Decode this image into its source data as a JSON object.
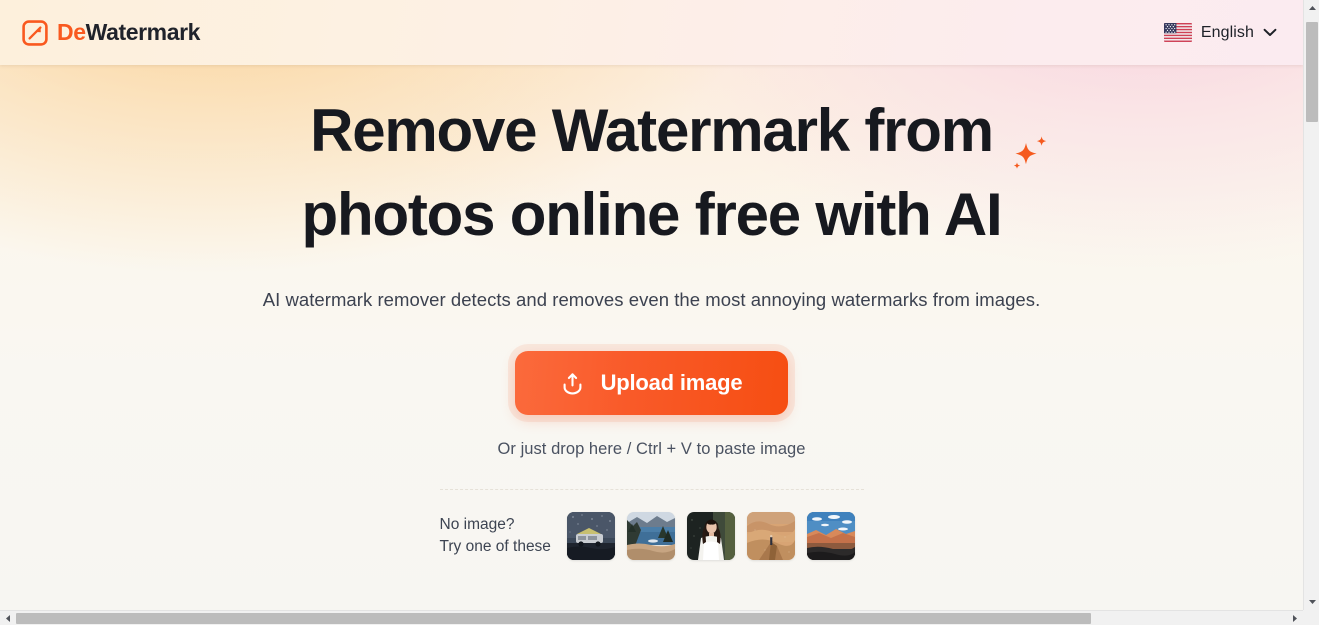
{
  "header": {
    "logo": {
      "icon": "dewatermark-logo-icon",
      "text_primary": "De",
      "text_secondary": "Watermark",
      "primary_color": "#f9591f",
      "secondary_color": "#20232b"
    },
    "language": {
      "flag_icon": "us-flag-icon",
      "label": "English",
      "chevron_icon": "chevron-down-icon"
    }
  },
  "hero": {
    "headline_line1": "Remove Watermark from",
    "headline_line2": "photos online free with AI",
    "sparkle_icon": "sparkle-icon",
    "sparkle_color": "#f55a1e",
    "subtitle": "AI watermark remover detects and removes even the most annoying watermarks from images.",
    "upload": {
      "icon": "upload-icon",
      "label": "Upload image",
      "accent_color": "#f75c28"
    },
    "drop_hint": "Or just drop here / Ctrl + V to paste image"
  },
  "samples": {
    "label_line1": "No image?",
    "label_line2": "Try one of these",
    "thumbnails": [
      {
        "name": "sample-camper-van-night",
        "alt": "Camper van under starry night sky"
      },
      {
        "name": "sample-mountain-lake",
        "alt": "Mountain lake with pine trees"
      },
      {
        "name": "sample-woman-portrait",
        "alt": "Woman in white dress portrait"
      },
      {
        "name": "sample-desert-dunes",
        "alt": "Person walking on desert dunes"
      },
      {
        "name": "sample-canyon-landscape",
        "alt": "Canyon landscape with blue sky"
      }
    ]
  },
  "scrollbars": {
    "vertical": {
      "up_icon": "scroll-up-arrow-icon",
      "down_icon": "scroll-down-arrow-icon"
    },
    "horizontal": {
      "left_icon": "scroll-left-arrow-icon",
      "right_icon": "scroll-right-arrow-icon"
    }
  }
}
